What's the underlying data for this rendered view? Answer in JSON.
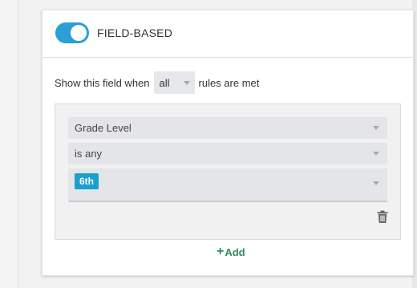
{
  "header": {
    "toggle_on": true,
    "title": "FIELD-BASED"
  },
  "condition": {
    "prefix": "Show this field when",
    "match_mode": "all",
    "suffix": "rules are met"
  },
  "rule": {
    "field": "Grade Level",
    "operator": "is any",
    "values": [
      "6th"
    ]
  },
  "actions": {
    "add_label": "Add"
  },
  "colors": {
    "accent": "#2a9fd6",
    "tag": "#1a9fd1",
    "add_link": "#2f8a63"
  },
  "icons": {
    "delete": "trash-icon",
    "add": "plus-icon",
    "dropdown": "caret-down-icon"
  }
}
